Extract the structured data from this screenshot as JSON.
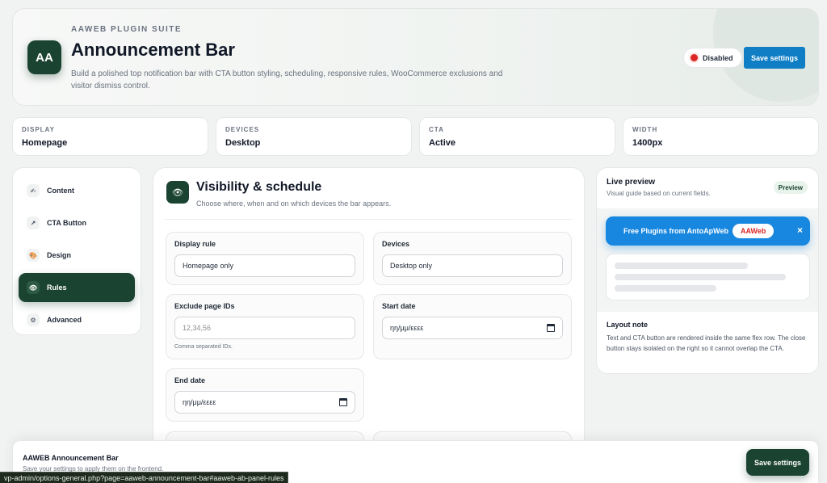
{
  "header": {
    "eyebrow": "AAWEB PLUGIN SUITE",
    "logo_text": "AA",
    "title": "Announcement Bar",
    "description": "Build a polished top notification bar with CTA button styling, scheduling, responsive rules, WooCommerce exclusions and visitor dismiss control.",
    "status_label": "Disabled",
    "status_color": "#dc2626",
    "save_label": "Save settings"
  },
  "stats": [
    {
      "label": "DISPLAY",
      "value": "Homepage"
    },
    {
      "label": "DEVICES",
      "value": "Desktop"
    },
    {
      "label": "CTA",
      "value": "Active"
    },
    {
      "label": "WIDTH",
      "value": "1400px"
    }
  ],
  "sidebar": {
    "items": [
      {
        "label": "Content",
        "icon": "pencil-icon",
        "glyph": "✍",
        "active": false
      },
      {
        "label": "CTA Button",
        "icon": "arrow-icon",
        "glyph": "↗",
        "active": false
      },
      {
        "label": "Design",
        "icon": "palette-icon",
        "glyph": "🎨",
        "active": false
      },
      {
        "label": "Rules",
        "icon": "eye-icon",
        "glyph": "👁",
        "active": true
      },
      {
        "label": "Advanced",
        "icon": "gear-icon",
        "glyph": "⚙",
        "active": false
      }
    ]
  },
  "main": {
    "icon": "eye-icon",
    "title": "Visibility & schedule",
    "subtitle": "Choose where, when and on which devices the bar appears.",
    "fields": {
      "display_rule": {
        "label": "Display rule",
        "value": "Homepage only"
      },
      "devices": {
        "label": "Devices",
        "value": "Desktop only"
      },
      "exclude_ids": {
        "label": "Exclude page IDs",
        "placeholder": "12,34,56",
        "hint": "Comma separated IDs."
      },
      "start_date": {
        "label": "Start date",
        "value": "ηη/μμ/εεεε"
      },
      "end_date": {
        "label": "End date",
        "value": "ηη/μμ/εεεε"
      }
    }
  },
  "preview": {
    "title": "Live preview",
    "subtitle": "Visual guide based on current fields.",
    "badge": "Preview",
    "bar_text": "Free Plugins from AntoApWeb",
    "bar_cta": "AAWeb",
    "bar_close": "×",
    "bar_color": "#1787e0",
    "note_title": "Layout note",
    "note": "Text and CTA button are rendered inside the same flex row. The close button stays isolated on the right so it cannot overlap the CTA."
  },
  "footer": {
    "title": "AAWEB Announcement Bar",
    "subtitle": "Save your settings to apply them on the frontend.",
    "save_label": "Save settings"
  },
  "statusbar": {
    "url": "vp-admin/options-general.php?page=aaweb-announcement-bar#aaweb-ab-panel-rules"
  }
}
